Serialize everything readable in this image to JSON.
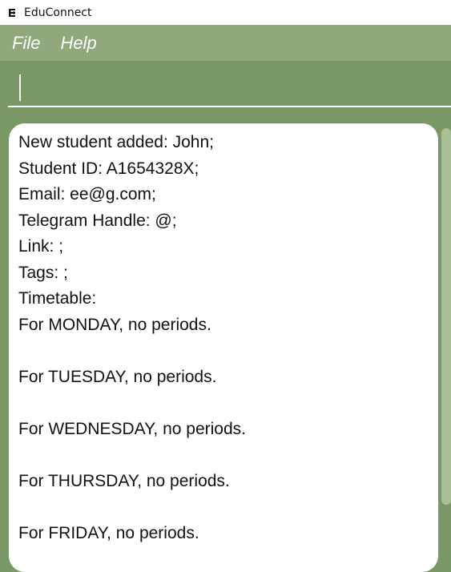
{
  "window": {
    "title": "EduConnect",
    "icon": "educonnect-app-icon"
  },
  "menubar": {
    "items": [
      {
        "label": "File"
      },
      {
        "label": "Help"
      }
    ]
  },
  "command_box": {
    "value": "",
    "placeholder": ""
  },
  "result_display": {
    "lines": [
      "New student added: John;",
      "Student ID: A1654328X;",
      "Email: ee@g.com;",
      "Telegram Handle: @;",
      "Link: ;",
      "Tags: ;",
      "Timetable:",
      "For MONDAY, no periods.",
      "",
      "For TUESDAY, no periods.",
      "",
      "For WEDNESDAY, no periods.",
      "",
      "For THURSDAY, no periods.",
      "",
      "For FRIDAY, no periods."
    ]
  },
  "colors": {
    "background": "#7a9866",
    "menubar": "#8fa97c",
    "panel": "#ffffff",
    "scroll_thumb": "#a9bf97"
  }
}
